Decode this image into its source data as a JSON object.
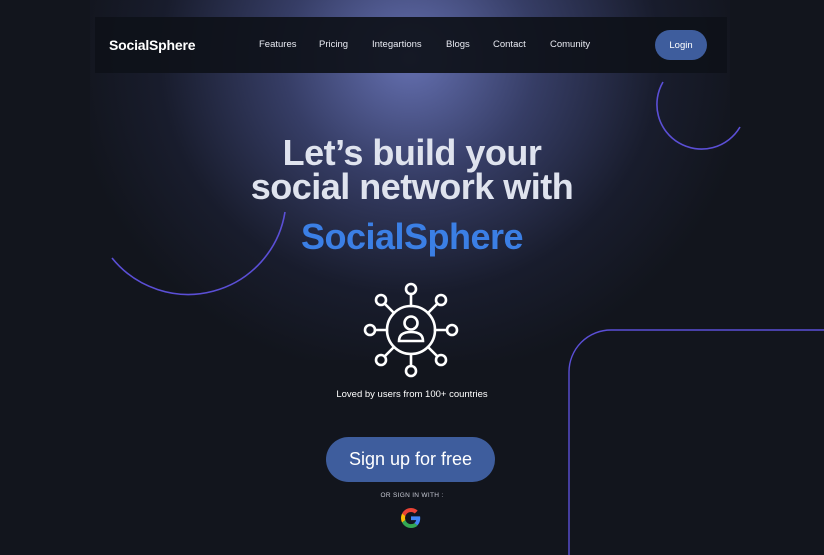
{
  "brand": {
    "name": "SocialSphere"
  },
  "nav": {
    "links": [
      "Features",
      "Pricing",
      "Integartions",
      "Blogs",
      "Contact",
      "Comunity"
    ],
    "login_label": "Login"
  },
  "hero": {
    "title_line1": "Let’s build your",
    "title_line2": "social network with",
    "title_brand": "SocialSphere",
    "tagline": "Loved by users from 100+ countries",
    "signup_label": "Sign up for free",
    "or_sign_in": "OR SIGN IN WITH :"
  },
  "icons": {
    "network": "network-user-icon",
    "google": "google-icon"
  },
  "colors": {
    "background": "#12151d",
    "accent_button": "#3e5d9d",
    "brand_text": "#3b7fe5",
    "title_text": "#dfe3ee",
    "decor_line": "#5b4fd6"
  }
}
